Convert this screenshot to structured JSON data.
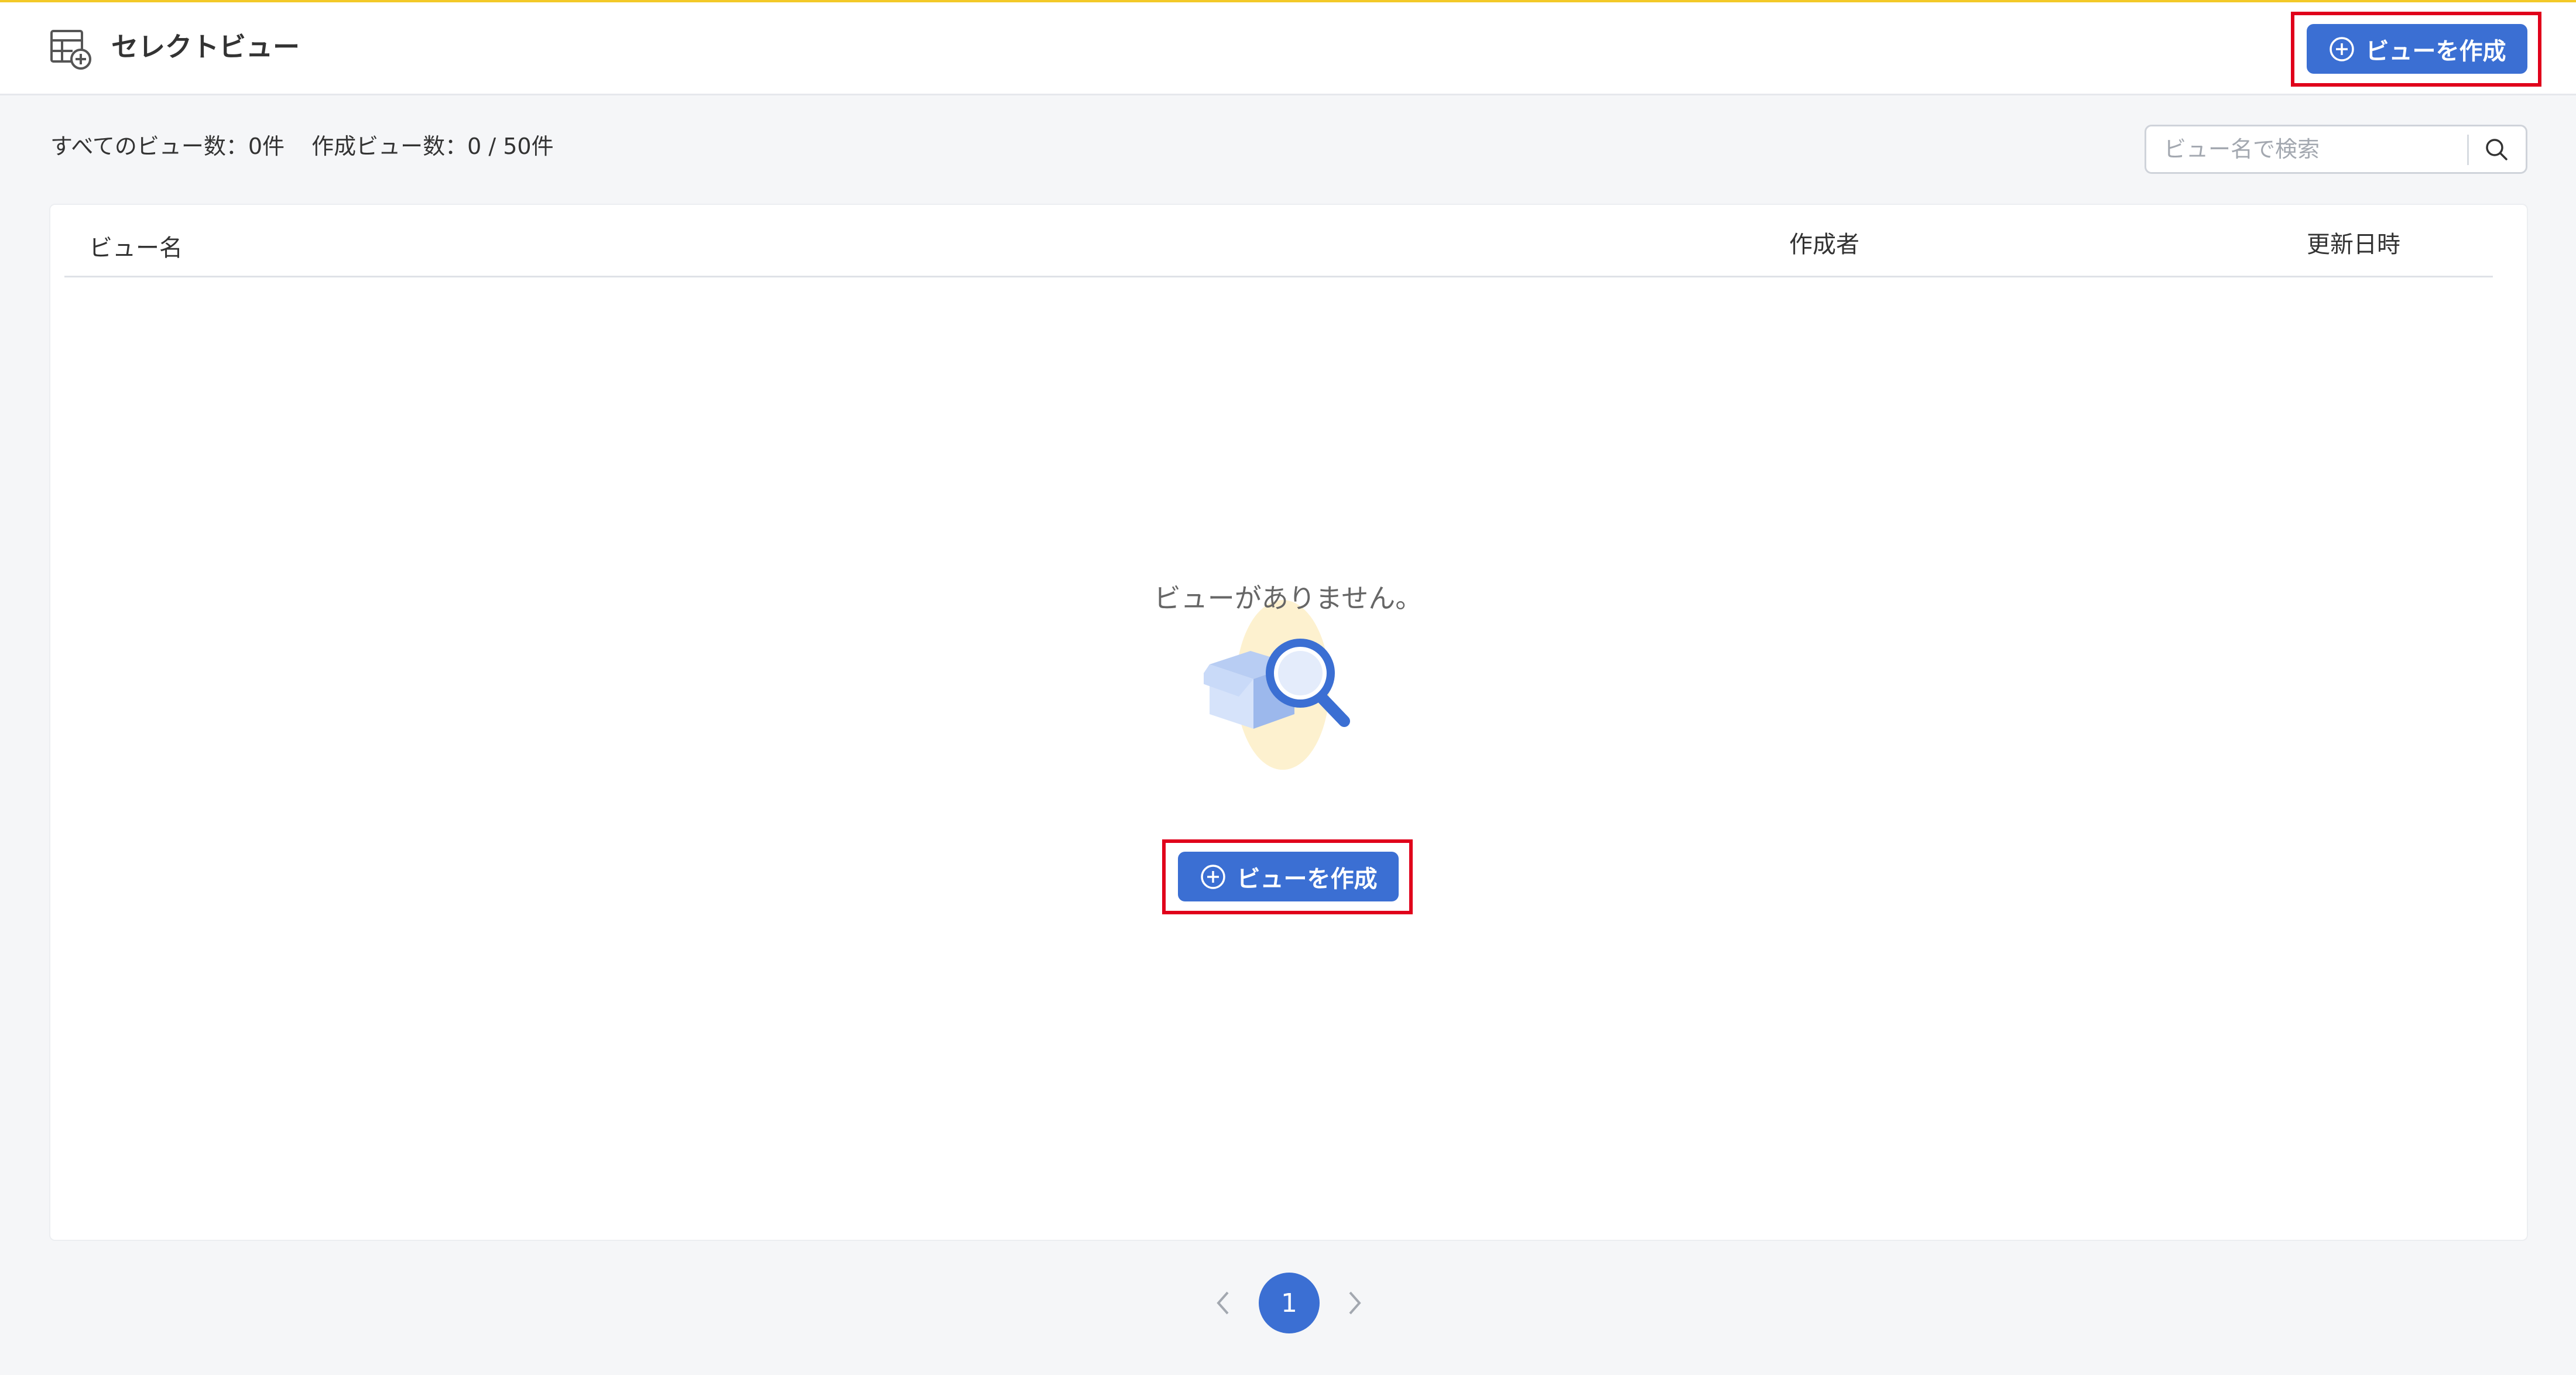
{
  "header": {
    "title": "セレクトビュー",
    "icon": "table-add-icon",
    "create_button_label": "ビューを作成"
  },
  "summary": {
    "all_views": "すべてのビュー数：0件",
    "created_views": "作成ビュー数：0 / 50件"
  },
  "search": {
    "placeholder": "ビュー名で検索",
    "value": ""
  },
  "table": {
    "columns": [
      "ビュー名",
      "作成者",
      "更新日時"
    ],
    "rows": []
  },
  "empty_state": {
    "message": "ビューがありません。",
    "create_button_label": "ビューを作成",
    "illustration": "empty-box-search-icon"
  },
  "pagination": {
    "current_page": "1"
  },
  "colors": {
    "primary": "#3b6fd3",
    "highlight": "#e0001b",
    "header_accent": "#f3c928"
  }
}
